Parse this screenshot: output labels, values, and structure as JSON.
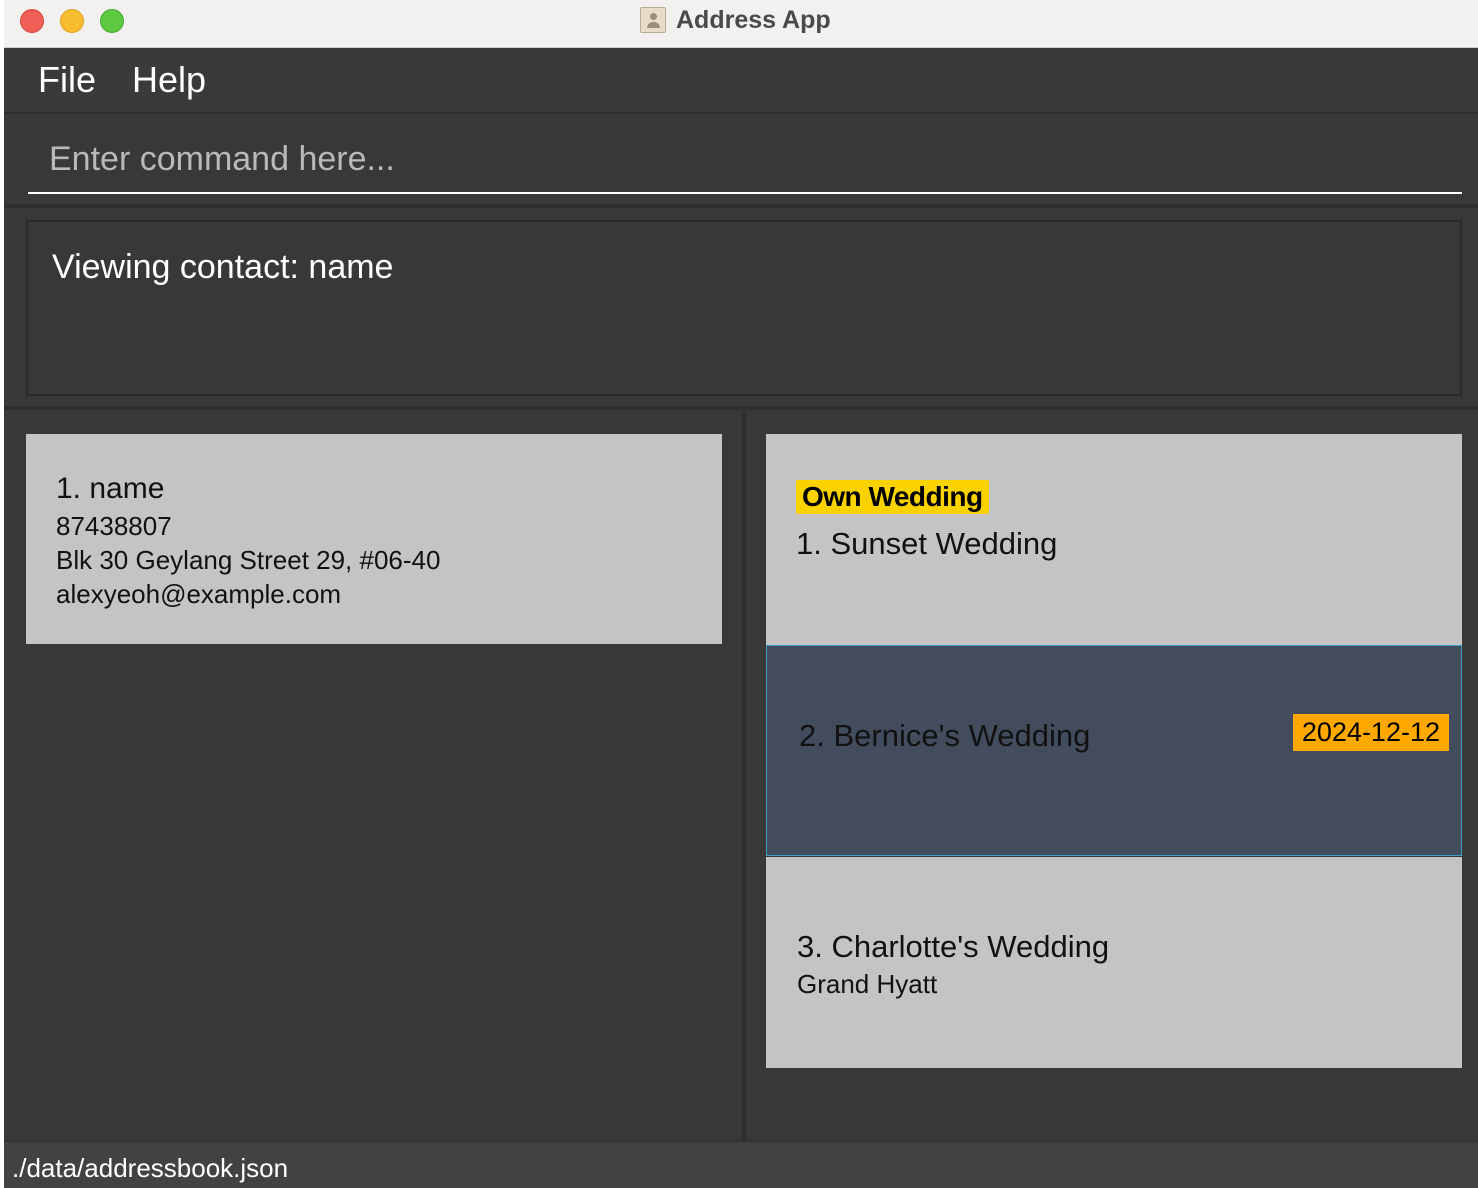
{
  "window": {
    "title": "Address App"
  },
  "menu": {
    "file": "File",
    "help": "Help"
  },
  "command": {
    "placeholder": "Enter command here...",
    "value": ""
  },
  "result": {
    "text": "Viewing contact: name"
  },
  "contacts": [
    {
      "title": "1. name",
      "phone": "87438807",
      "address": "Blk 30 Geylang Street 29, #06-40",
      "email": "alexyeoh@example.com"
    }
  ],
  "weddings": [
    {
      "tag": "Own Wedding",
      "title": "1. Sunset Wedding",
      "selected": false
    },
    {
      "title": "2. Bernice's Wedding",
      "date": "2024-12-12",
      "selected": true
    },
    {
      "title": "3. Charlotte's Wedding",
      "venue": "Grand Hyatt",
      "selected": false
    }
  ],
  "status": {
    "path": "./data/addressbook.json"
  },
  "colors": {
    "own_tag": "#f9d200",
    "date_tag": "#ffa900",
    "selected_card": "#434c5d",
    "card": "#c4c4c4",
    "background": "#383838"
  }
}
